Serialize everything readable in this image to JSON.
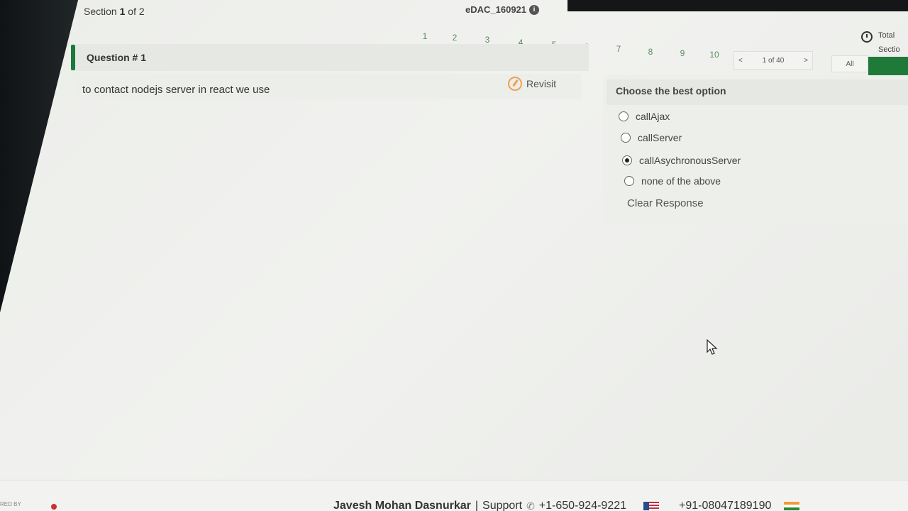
{
  "header": {
    "section_prefix": "Section",
    "section_current": "1",
    "section_suffix": "of 2",
    "exam_title": "eDAC_160921",
    "question_numbers": [
      "1",
      "2",
      "3",
      "4",
      "5",
      "6",
      "7",
      "8",
      "9",
      "10"
    ],
    "pager": {
      "prev": "<",
      "label": "1 of 40",
      "next": ">"
    },
    "timer_line1": "Total",
    "timer_line2": "Sectio",
    "filter_label": "All"
  },
  "question": {
    "title": "Question # 1",
    "revisit_label": "Revisit",
    "text": "to contact nodejs server  in react we use"
  },
  "options": {
    "title": "Choose the best option",
    "items": [
      {
        "label": "callAjax",
        "selected": false
      },
      {
        "label": "callServer",
        "selected": false
      },
      {
        "label": "callAsychronousServer",
        "selected": true
      },
      {
        "label": "none of the above",
        "selected": false
      }
    ],
    "clear_label": "Clear Response"
  },
  "footer": {
    "powered": "RED BY",
    "user_name": "Javesh Mohan Dasnurkar",
    "separator": "|",
    "support_label": "Support",
    "phone_us": "+1-650-924-9221",
    "phone_in": "+91-08047189190"
  },
  "colors": {
    "accent_green": "#1a7a3a",
    "revisit_orange": "#f0a050"
  }
}
